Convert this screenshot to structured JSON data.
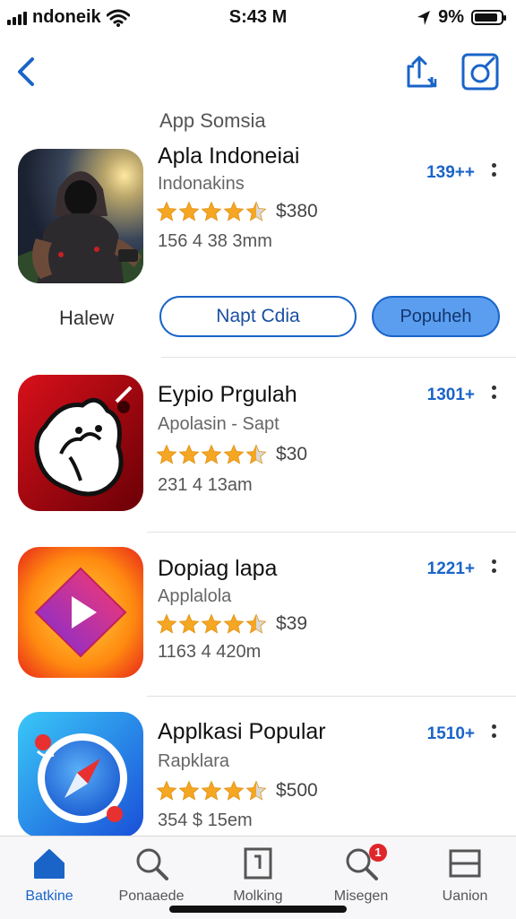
{
  "status_bar": {
    "carrier": "ndoneik",
    "time": "S:43 M",
    "battery": "9%"
  },
  "section": {
    "title": "App Somsia"
  },
  "featured": {
    "name": "Apla Indoneiai",
    "subtitle": "Indonakins",
    "rating": 4.5,
    "price": "$380",
    "meta": "156 4 38 3mm",
    "count": "139++",
    "side_label": "Halew",
    "primary_button": "Napt Cdia",
    "secondary_button": "Popuheh"
  },
  "apps": [
    {
      "name": "Eypio Prgulah",
      "subtitle": "Apolasin - Sapt",
      "rating": 4.5,
      "price": "$30",
      "meta": "231 4 13am",
      "count": "1301+"
    },
    {
      "name": "Dopiag lapa",
      "subtitle": "Applalola",
      "rating": 4.5,
      "price": "$39",
      "meta": "1163 4 420m",
      "count": "1221+"
    },
    {
      "name": "Applkasi Popular",
      "subtitle": "Rapklara",
      "rating": 4.5,
      "price": "$500",
      "meta": "354 $ 15em",
      "count": "1510+"
    }
  ],
  "tab_bar": {
    "items": [
      {
        "label": "Batkine",
        "icon": "home-icon",
        "active": true
      },
      {
        "label": "Ponaaede",
        "icon": "search-icon"
      },
      {
        "label": "Molking",
        "icon": "book-icon"
      },
      {
        "label": "Misegen",
        "icon": "search-badge-icon",
        "badge": "1"
      },
      {
        "label": "Uanion",
        "icon": "window-icon"
      }
    ]
  },
  "colors": {
    "accent": "#1a64c8",
    "star": "#f5a623",
    "badge": "#e0262a"
  }
}
